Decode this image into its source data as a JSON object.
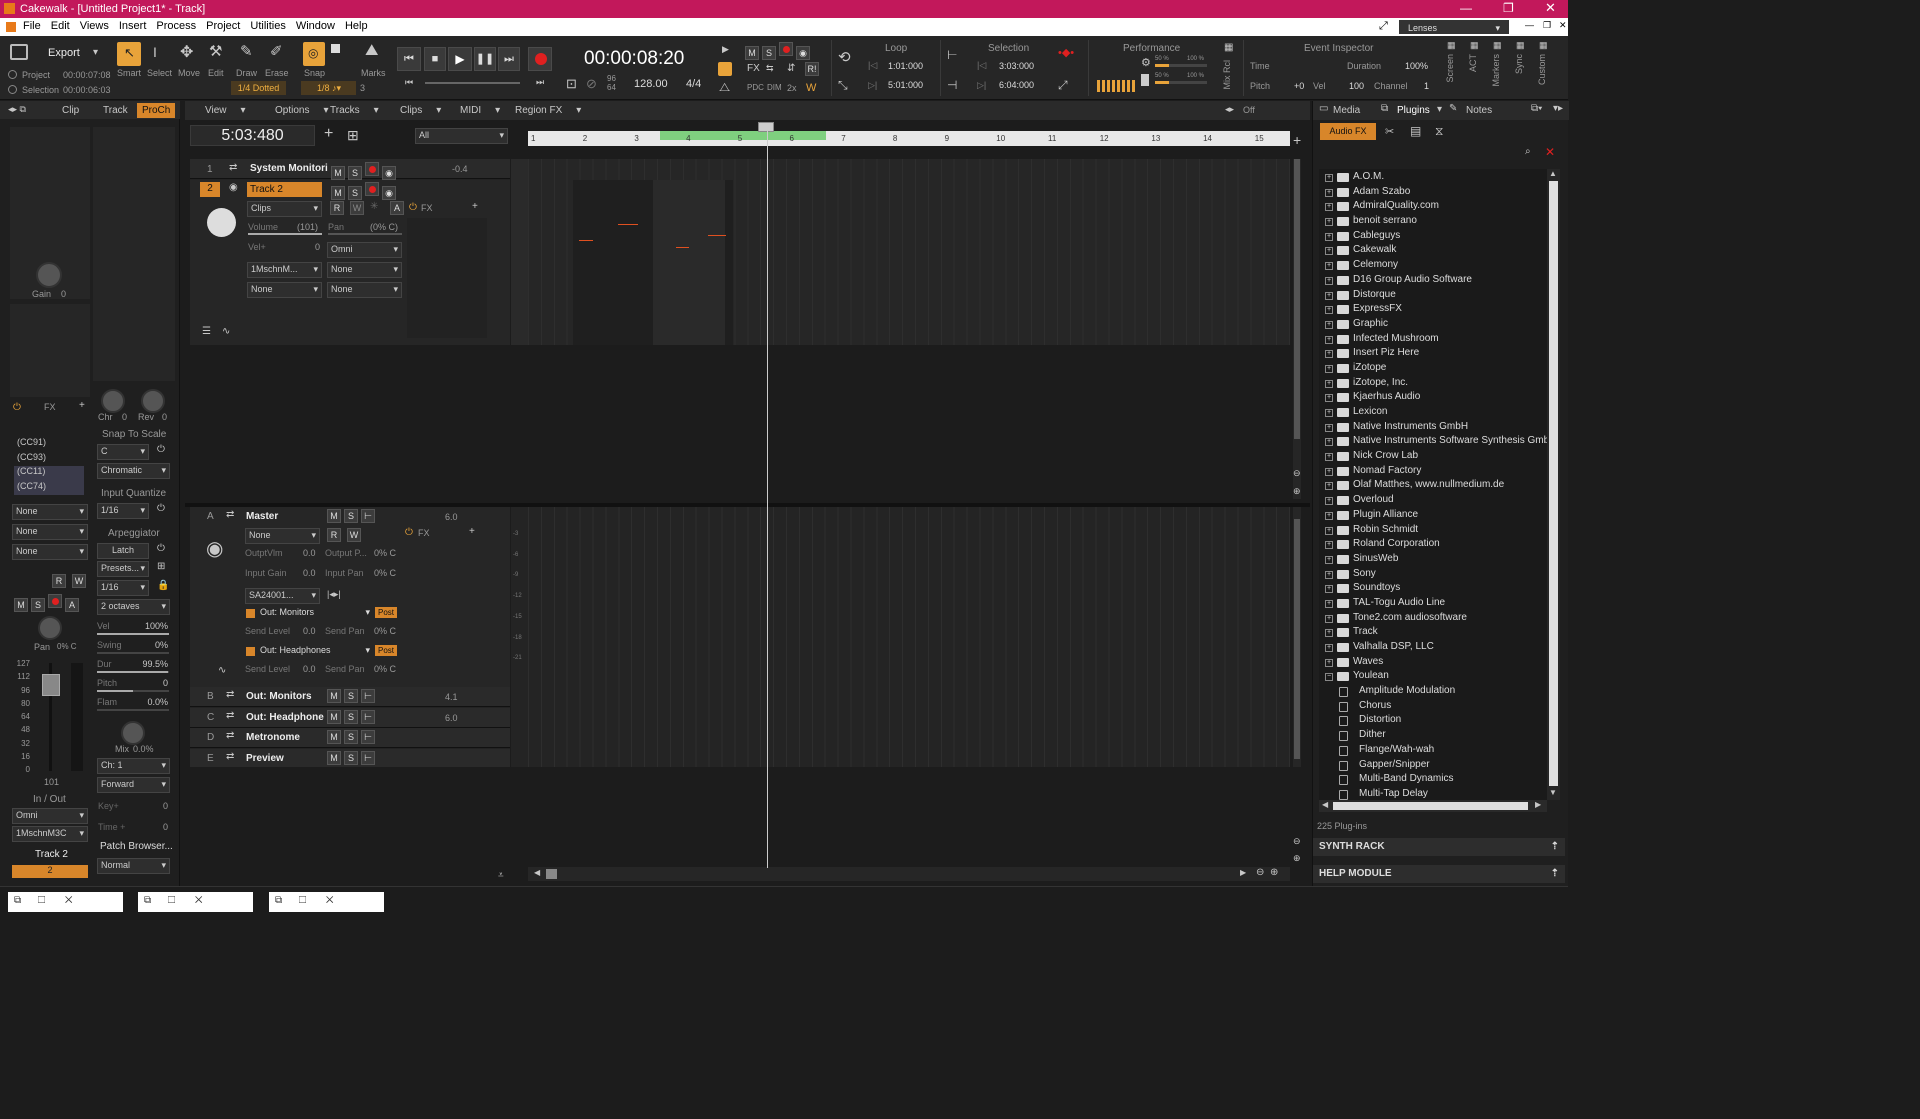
{
  "window": {
    "title": "Cakewalk - [Untitled Project1* - Track]"
  },
  "menu": [
    "File",
    "Edit",
    "Views",
    "Insert",
    "Process",
    "Project",
    "Utilities",
    "Window",
    "Help"
  ],
  "lenses": "Lenses",
  "control": {
    "export": "Export",
    "project_lbl": "Project",
    "project_time": "00:00:07:08",
    "selection_lbl": "Selection",
    "selection_time": "00:00:06:03",
    "tools": [
      "Smart",
      "Select",
      "Move",
      "Edit",
      "Draw",
      "Erase"
    ],
    "snap": "Snap",
    "marks": "Marks",
    "snap_dotted": "1/4 Dotted",
    "snap_val": "1/8",
    "snap_num": "3",
    "time": "00:00:08:20",
    "sr_top": "96",
    "sr_bot": "64",
    "tempo": "128.00",
    "meter": "4/4",
    "loop_title": "Loop",
    "loop_start": "1:01:000",
    "loop_end": "5:01:000",
    "sel_title": "Selection",
    "sel_start": "3:03:000",
    "sel_end": "6:04:000",
    "perf_title": "Performance",
    "perf_pct": "50 %",
    "perf_pct2": "100 %",
    "ei_title": "Event Inspector",
    "ei_time": "Time",
    "ei_duration": "Duration",
    "ei_dur_val": "100%",
    "ei_pitch": "Pitch",
    "ei_pitch_val": "+0",
    "ei_vel": "Vel",
    "ei_vel_val": "100",
    "ei_channel": "Channel",
    "ei_ch_val": "1",
    "side_tabs": [
      "Mix Rcl",
      "Screen",
      "ACT",
      "Markers",
      "Sync",
      "Custom"
    ],
    "fx_lbl": "FX",
    "pdc": "PDC",
    "dim": "DIM",
    "x2": "2x"
  },
  "inspector": {
    "tabs": [
      "Clip",
      "Track",
      "ProCh"
    ],
    "gain_lbl": "Gain",
    "gain_val": "0",
    "fx": "FX",
    "cc": [
      "(CC91)",
      "(CC93)",
      "(CC11)",
      "(CC74)"
    ],
    "none": "None",
    "pan": "Pan",
    "pan_val": "0% C",
    "fader_scale": [
      "127",
      "112",
      "96",
      "80",
      "64",
      "48",
      "32",
      "16",
      "0"
    ],
    "fader_val": "101",
    "inout": "In / Out",
    "omni": "Omni",
    "port": "1MschnM3C",
    "track_name": "Track 2",
    "track_num": "2",
    "chr": "Chr",
    "rev": "Rev",
    "knob0": "0",
    "snap_scale": "Snap To Scale",
    "key": "C",
    "scale": "Chromatic",
    "input_q": "Input Quantize",
    "q_val": "1/16",
    "arp": "Arpeggiator",
    "latch": "Latch",
    "presets": "Presets...",
    "arp_rate": "1/16",
    "octaves": "2 octaves",
    "vel": "Vel",
    "vel_val": "100%",
    "swing": "Swing",
    "swing_val": "0%",
    "dur": "Dur",
    "dur_val": "99.5%",
    "pitch": "Pitch",
    "pitch_val": "0",
    "flam": "Flam",
    "flam_val": "0.0%",
    "mix": "Mix",
    "mix_val": "0.0%",
    "ch": "Ch: 1",
    "forward": "Forward",
    "keyp": "Key+",
    "keyp_val": "0",
    "timep": "Time +",
    "timep_val": "0",
    "patch": "Patch Browser...",
    "normal": "Normal"
  },
  "trackview": {
    "menus": [
      "View",
      "Options",
      "Tracks",
      "Clips",
      "MIDI",
      "Region FX"
    ],
    "now": "5:03:480",
    "filter": "All",
    "ruler": [
      "1",
      "2",
      "3",
      "4",
      "5",
      "6",
      "7",
      "8",
      "9",
      "10",
      "11",
      "12",
      "13",
      "14",
      "15"
    ],
    "tracks": [
      {
        "num": "1",
        "name": "System Monitori",
        "val": "-0.4"
      },
      {
        "num": "2",
        "name": "Track 2",
        "clips": "Clips",
        "volume": "Volume",
        "volume_val": "(101)",
        "pan": "Pan",
        "pan_val": "(0% C)",
        "velp": "Vel+",
        "velp_val": "0",
        "omni": "Omni",
        "port": "1MschnM...",
        "none": "None",
        "fx": "FX"
      }
    ],
    "buses": [
      {
        "letter": "A",
        "name": "Master",
        "val": "6.0",
        "none": "None",
        "fx": "FX",
        "outvol": "OutptVlm",
        "outvol_v": "0.0",
        "outpan": "Output P...",
        "outpan_v": "0% C",
        "ingain": "Input Gain",
        "ingain_v": "0.0",
        "inpan": "Input Pan",
        "inpan_v": "0% C",
        "device": "SA24001...",
        "sends": [
          {
            "name": "Out: Monitors",
            "post": "Post",
            "level": "Send Level",
            "level_v": "0.0",
            "pan": "Send Pan",
            "pan_v": "0% C"
          },
          {
            "name": "Out: Headphones",
            "post": "Post",
            "level": "Send Level",
            "level_v": "0.0",
            "pan": "Send Pan",
            "pan_v": "0% C"
          }
        ]
      },
      {
        "letter": "B",
        "name": "Out: Monitors",
        "val": "4.1"
      },
      {
        "letter": "C",
        "name": "Out: Headphone",
        "val": "6.0"
      },
      {
        "letter": "D",
        "name": "Metronome",
        "val": ""
      },
      {
        "letter": "E",
        "name": "Preview",
        "val": ""
      }
    ],
    "meter_scale": [
      "-3",
      "-6",
      "-9",
      "-12",
      "-15",
      "-18",
      "-21"
    ],
    "loop_marker": "Off"
  },
  "browser": {
    "tabs": [
      "Media",
      "Plugins",
      "Notes"
    ],
    "audio_fx": "Audio FX",
    "folders": [
      "A.O.M.",
      "Adam Szabo",
      "AdmiralQuality.com",
      "benoit serrano",
      "Cableguys",
      "Cakewalk",
      "Celemony",
      "D16 Group Audio Software",
      "Distorque",
      "ExpressFX",
      "Graphic",
      "Infected Mushroom",
      "Insert Piz Here",
      "iZotope",
      "iZotope, Inc.",
      "Kjaerhus Audio",
      "Lexicon",
      "Native Instruments GmbH",
      "Native Instruments Software Synthesis Gmb",
      "Nick Crow Lab",
      "Nomad Factory",
      "Olaf Matthes, www.nullmedium.de",
      "Overloud",
      "Plugin Alliance",
      "Robin Schmidt",
      "Roland Corporation",
      "SinusWeb",
      "Sony",
      "Soundtoys",
      "TAL-Togu Audio Line",
      "Tone2.com audiosoftware",
      "Track",
      "Valhalla DSP, LLC",
      "Waves",
      "Youlean"
    ],
    "plugins": [
      "Amplitude Modulation",
      "Chorus",
      "Distortion",
      "Dither",
      "Flange/Wah-wah",
      "Gapper/Snipper",
      "Multi-Band Dynamics",
      "Multi-Tap Delay"
    ],
    "count": "225 Plug-ins",
    "synth_rack": "SYNTH RACK",
    "help_module": "HELP MODULE"
  }
}
